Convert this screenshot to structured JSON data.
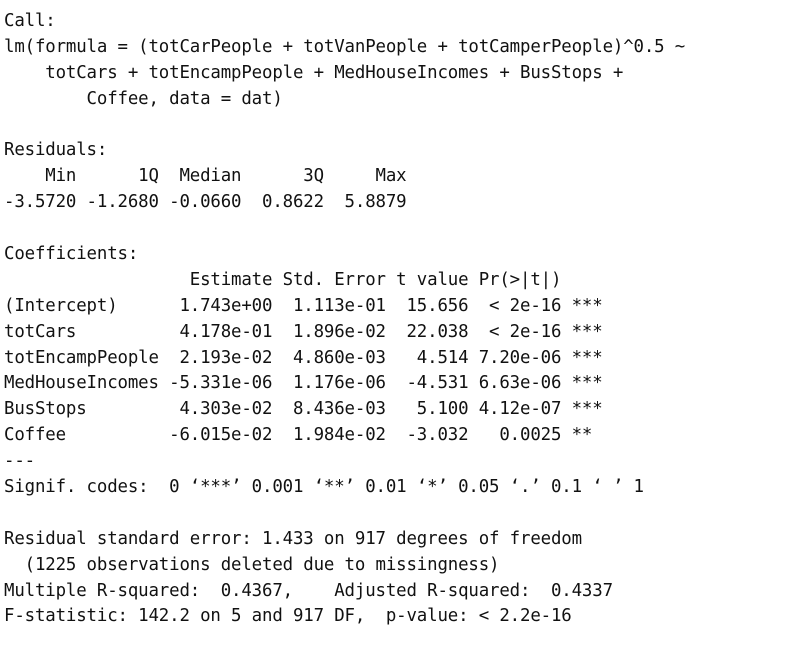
{
  "call": {
    "header": "Call:",
    "lines": [
      "lm(formula = (totCarPeople + totVanPeople + totCamperPeople)^0.5 ~",
      "    totCars + totEncampPeople + MedHouseIncomes + BusStops +",
      "        Coffee, data = dat)"
    ]
  },
  "residuals": {
    "header": "Residuals:",
    "labels_row": "    Min      1Q  Median      3Q     Max ",
    "values_row": "-3.5720 -1.2680 -0.0660  0.8622  5.8879 "
  },
  "coefficients": {
    "header": "Coefficients:",
    "column_header_row": "                  Estimate Std. Error t value Pr(>|t|)    ",
    "rows": [
      "(Intercept)      1.743e+00  1.113e-01  15.656  < 2e-16 ***",
      "totCars          4.178e-01  1.896e-02  22.038  < 2e-16 ***",
      "totEncampPeople  2.193e-02  4.860e-03   4.514 7.20e-06 ***",
      "MedHouseIncomes -5.331e-06  1.176e-06  -4.531 6.63e-06 ***",
      "BusStops         4.303e-02  8.436e-03   5.100 4.12e-07 ***",
      "Coffee          -6.015e-02  1.984e-02  -3.032   0.0025 ** "
    ],
    "separator": "---",
    "signif_codes": "Signif. codes:  0 ‘***’ 0.001 ‘**’ 0.01 ‘*’ 0.05 ‘.’ 0.1 ‘ ’ 1"
  },
  "summary": {
    "residual_se": "Residual standard error: 1.433 on 917 degrees of freedom",
    "missingness": "  (1225 observations deleted due to missingness)",
    "r_squared": "Multiple R-squared:  0.4367,\tAdjusted R-squared:  0.4337 ",
    "f_statistic": "F-statistic: 142.2 on 5 and 917 DF,  p-value: < 2.2e-16"
  }
}
